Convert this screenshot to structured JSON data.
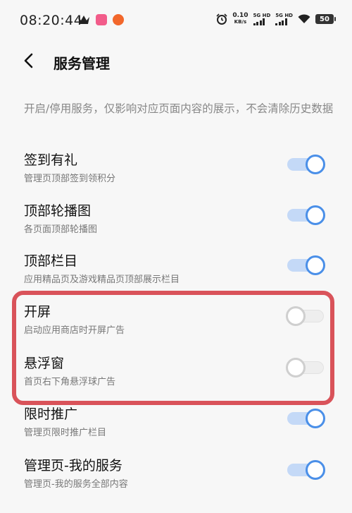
{
  "status_bar": {
    "time": "08:20:44",
    "speed_value": "0.10",
    "speed_unit": "KB/s",
    "sim1_label": "5G HD",
    "sim2_label": "5G HD",
    "battery": "50"
  },
  "header": {
    "title": "服务管理"
  },
  "description": "开启/停用服务，仅影响对应页面内容的展示，不会清除历史数据",
  "items": [
    {
      "title": "签到有礼",
      "subtitle": "管理页顶部签到领积分",
      "enabled": true
    },
    {
      "title": "顶部轮播图",
      "subtitle": "各页面顶部轮播图",
      "enabled": true
    },
    {
      "title": "顶部栏目",
      "subtitle": "应用精品页及游戏精品页顶部展示栏目",
      "enabled": true
    },
    {
      "title": "开屏",
      "subtitle": "启动应用商店时开屏广告",
      "enabled": false
    },
    {
      "title": "悬浮窗",
      "subtitle": "首页右下角悬浮球广告",
      "enabled": false
    },
    {
      "title": "限时推广",
      "subtitle": "管理页限时推广栏目",
      "enabled": true
    },
    {
      "title": "管理页-我的服务",
      "subtitle": "管理页-我的服务全部内容",
      "enabled": true
    }
  ],
  "colors": {
    "accent": "#4a8fe8",
    "highlight_border": "#d9535a"
  }
}
